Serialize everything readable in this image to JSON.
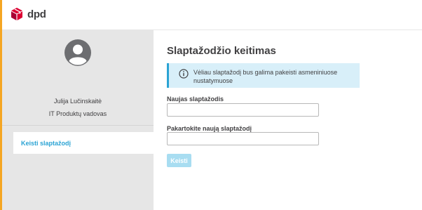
{
  "brand": {
    "logo_text": "dpd",
    "logo_color": "#dc0032",
    "accent_color": "#f5a623"
  },
  "sidebar": {
    "user_name": "Julija Lučinskaitė",
    "user_role": "IT Produktų vadovas",
    "items": [
      {
        "label": "Keisti slaptažodį",
        "active": true
      }
    ]
  },
  "main": {
    "title": "Slaptažodžio keitimas",
    "info_icon": "info-icon",
    "info_text": "Vėliau slaptažodį bus galima pakeisti asmeniniuose nustatymuose",
    "fields": [
      {
        "label": "Naujas slaptažodis",
        "value": ""
      },
      {
        "label": "Pakartokite naują slaptažodį",
        "value": ""
      }
    ],
    "submit_label": "Keisti",
    "submit_enabled": false
  },
  "colors": {
    "link": "#2aa3d4",
    "info_bg": "#d8eff9",
    "sidebar_bg": "#e6e6e6",
    "button_disabled": "#a8ddf1"
  }
}
